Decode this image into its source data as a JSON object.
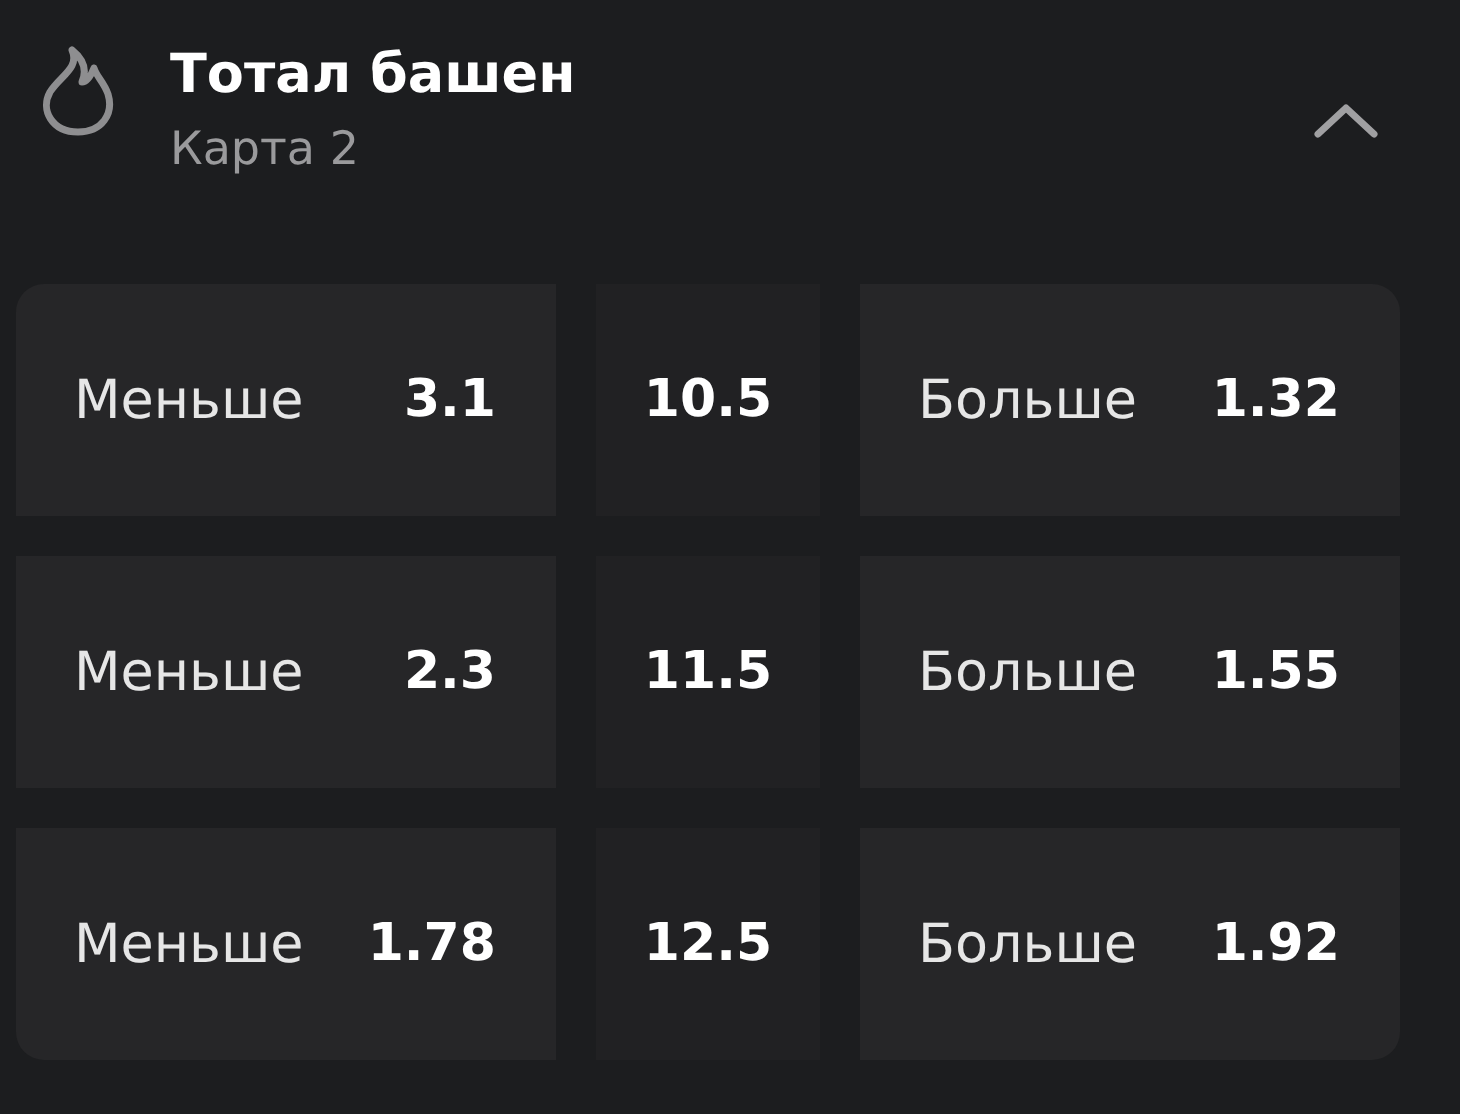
{
  "market": {
    "title": "Тотал башен",
    "subtitle": "Карта 2",
    "expanded": true
  },
  "rows": [
    {
      "under": {
        "label": "Меньше",
        "odds": "3.1"
      },
      "line": "10.5",
      "over": {
        "label": "Больше",
        "odds": "1.32"
      }
    },
    {
      "under": {
        "label": "Меньше",
        "odds": "2.3"
      },
      "line": "11.5",
      "over": {
        "label": "Больше",
        "odds": "1.55"
      }
    },
    {
      "under": {
        "label": "Меньше",
        "odds": "1.78"
      },
      "line": "12.5",
      "over": {
        "label": "Больше",
        "odds": "1.92"
      }
    }
  ]
}
